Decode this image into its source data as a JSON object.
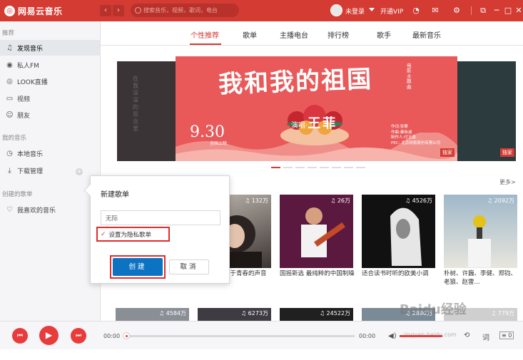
{
  "app": {
    "title": "网易云音乐",
    "logo_glyph": "◎"
  },
  "topbar": {
    "back": "‹",
    "forward": "›",
    "search_placeholder": "搜索音乐，视频，歌词，电台",
    "login": "未登录",
    "vip": "开通VIP",
    "icons": [
      "skin-icon",
      "mail-icon",
      "settings-icon",
      "mini-mode-icon",
      "minimize-icon",
      "maximize-icon",
      "close-icon"
    ]
  },
  "sidebar": {
    "recommend_head": "推荐",
    "recommend": [
      {
        "label": "发现音乐",
        "icon": "music-note-icon"
      },
      {
        "label": "私人FM",
        "icon": "radio-icon"
      },
      {
        "label": "LOOK直播",
        "icon": "live-icon"
      },
      {
        "label": "视频",
        "icon": "video-icon"
      },
      {
        "label": "朋友",
        "icon": "friends-icon"
      }
    ],
    "my_music_head": "我的音乐",
    "my_music": [
      {
        "label": "本地音乐",
        "icon": "local-music-icon"
      },
      {
        "label": "下载管理",
        "icon": "download-icon"
      }
    ],
    "created_head": "创建的歌单",
    "created": [
      {
        "label": "我喜欢的音乐",
        "icon": "heart-icon"
      }
    ]
  },
  "tabs": [
    "个性推荐",
    "歌单",
    "主播电台",
    "排行榜",
    "歌手",
    "最新音乐"
  ],
  "active_tab": 0,
  "banner": {
    "title": "我和我的祖国",
    "vertical_text": "电影主题曲",
    "date": "9.30",
    "date_sub": "全国上映",
    "singer_prefix": "演唱·",
    "singer": "王菲",
    "credits": [
      "作词:张藜",
      "作曲:秦咏诚",
      "制作人:付玉鑫",
      "PEC: 北京网易股份有限公司"
    ],
    "badge": "独家",
    "dot_count": 8,
    "active_dot": 0,
    "left_side_text": "在我深深的思念里"
  },
  "more_link": "更多>",
  "cards": [
    {
      "count": "132万",
      "caption": "那些关于青春的声音"
    },
    {
      "count": "26万",
      "caption": "国摇新选 最纯粹的中国制噪"
    },
    {
      "count": "4526万",
      "caption": "适合读书时听的欧美小调"
    },
    {
      "count": "2092万",
      "caption": "朴树、许巍、李健、郑钧、老狼、赵雷..."
    }
  ],
  "cards_row2": [
    "4584万",
    "6273万",
    "24522万",
    "2880万",
    "779万"
  ],
  "dialog": {
    "title": "新建歌单",
    "input_value": "无际",
    "private_label": "设置为隐私歌单",
    "private_checked": true,
    "create_label": "创建",
    "cancel_label": "取消"
  },
  "player": {
    "elapsed": "00:00",
    "total": "00:00",
    "playlist_count": "0",
    "volume_fraction": 0.75
  },
  "watermark": {
    "text": "Baidu经验",
    "sub": "jingyan.baidu.com"
  },
  "colors": {
    "brand_red": "#d43b33",
    "create_blue": "#0c73c2",
    "highlight_red": "#e02c2c"
  }
}
